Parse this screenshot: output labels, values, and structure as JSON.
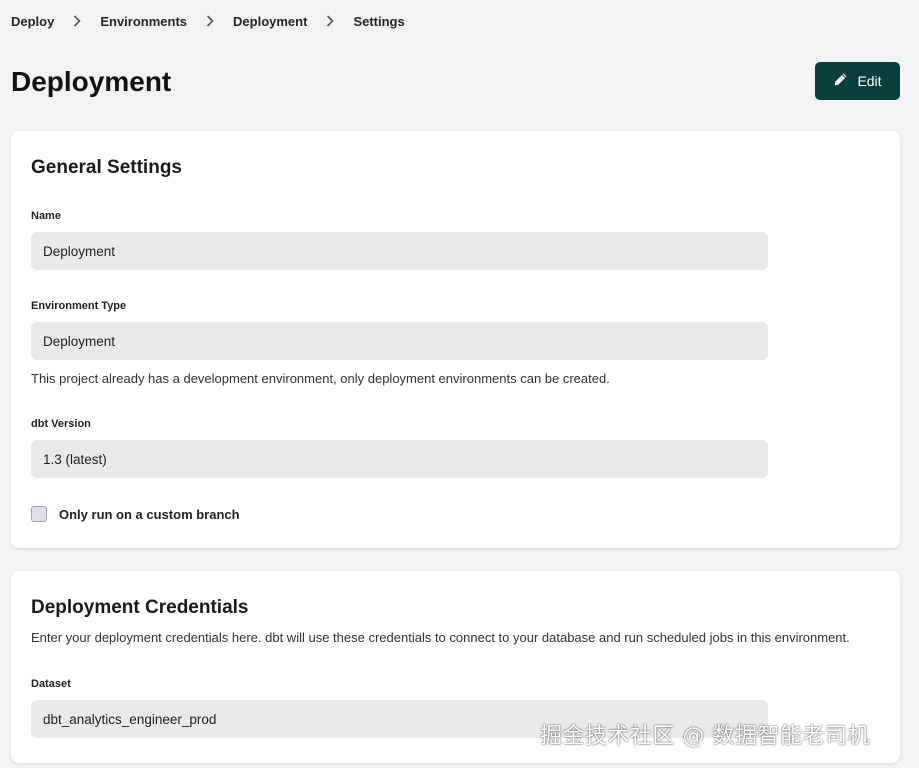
{
  "breadcrumb": {
    "items": [
      "Deploy",
      "Environments",
      "Deployment",
      "Settings"
    ]
  },
  "page": {
    "title": "Deployment",
    "edit_label": "Edit"
  },
  "general_settings": {
    "title": "General Settings",
    "name": {
      "label": "Name",
      "value": "Deployment"
    },
    "environment_type": {
      "label": "Environment Type",
      "value": "Deployment",
      "help": "This project already has a development environment, only deployment environments can be created."
    },
    "dbt_version": {
      "label": "dbt Version",
      "value": "1.3 (latest)"
    },
    "custom_branch": {
      "label": "Only run on a custom branch",
      "checked": false
    }
  },
  "deployment_credentials": {
    "title": "Deployment Credentials",
    "description": "Enter your deployment credentials here. dbt will use these credentials to connect to your database and run scheduled jobs in this environment.",
    "dataset": {
      "label": "Dataset",
      "value": "dbt_analytics_engineer_prod"
    }
  },
  "watermark": "掘金技术社区 @ 数据智能老司机",
  "colors": {
    "background": "#f2f3f5",
    "accent_button": "#0a3d3e",
    "field_bg": "#e9eaec"
  },
  "icons": {
    "separator": "chevron-right-icon",
    "edit": "pencil-icon"
  }
}
